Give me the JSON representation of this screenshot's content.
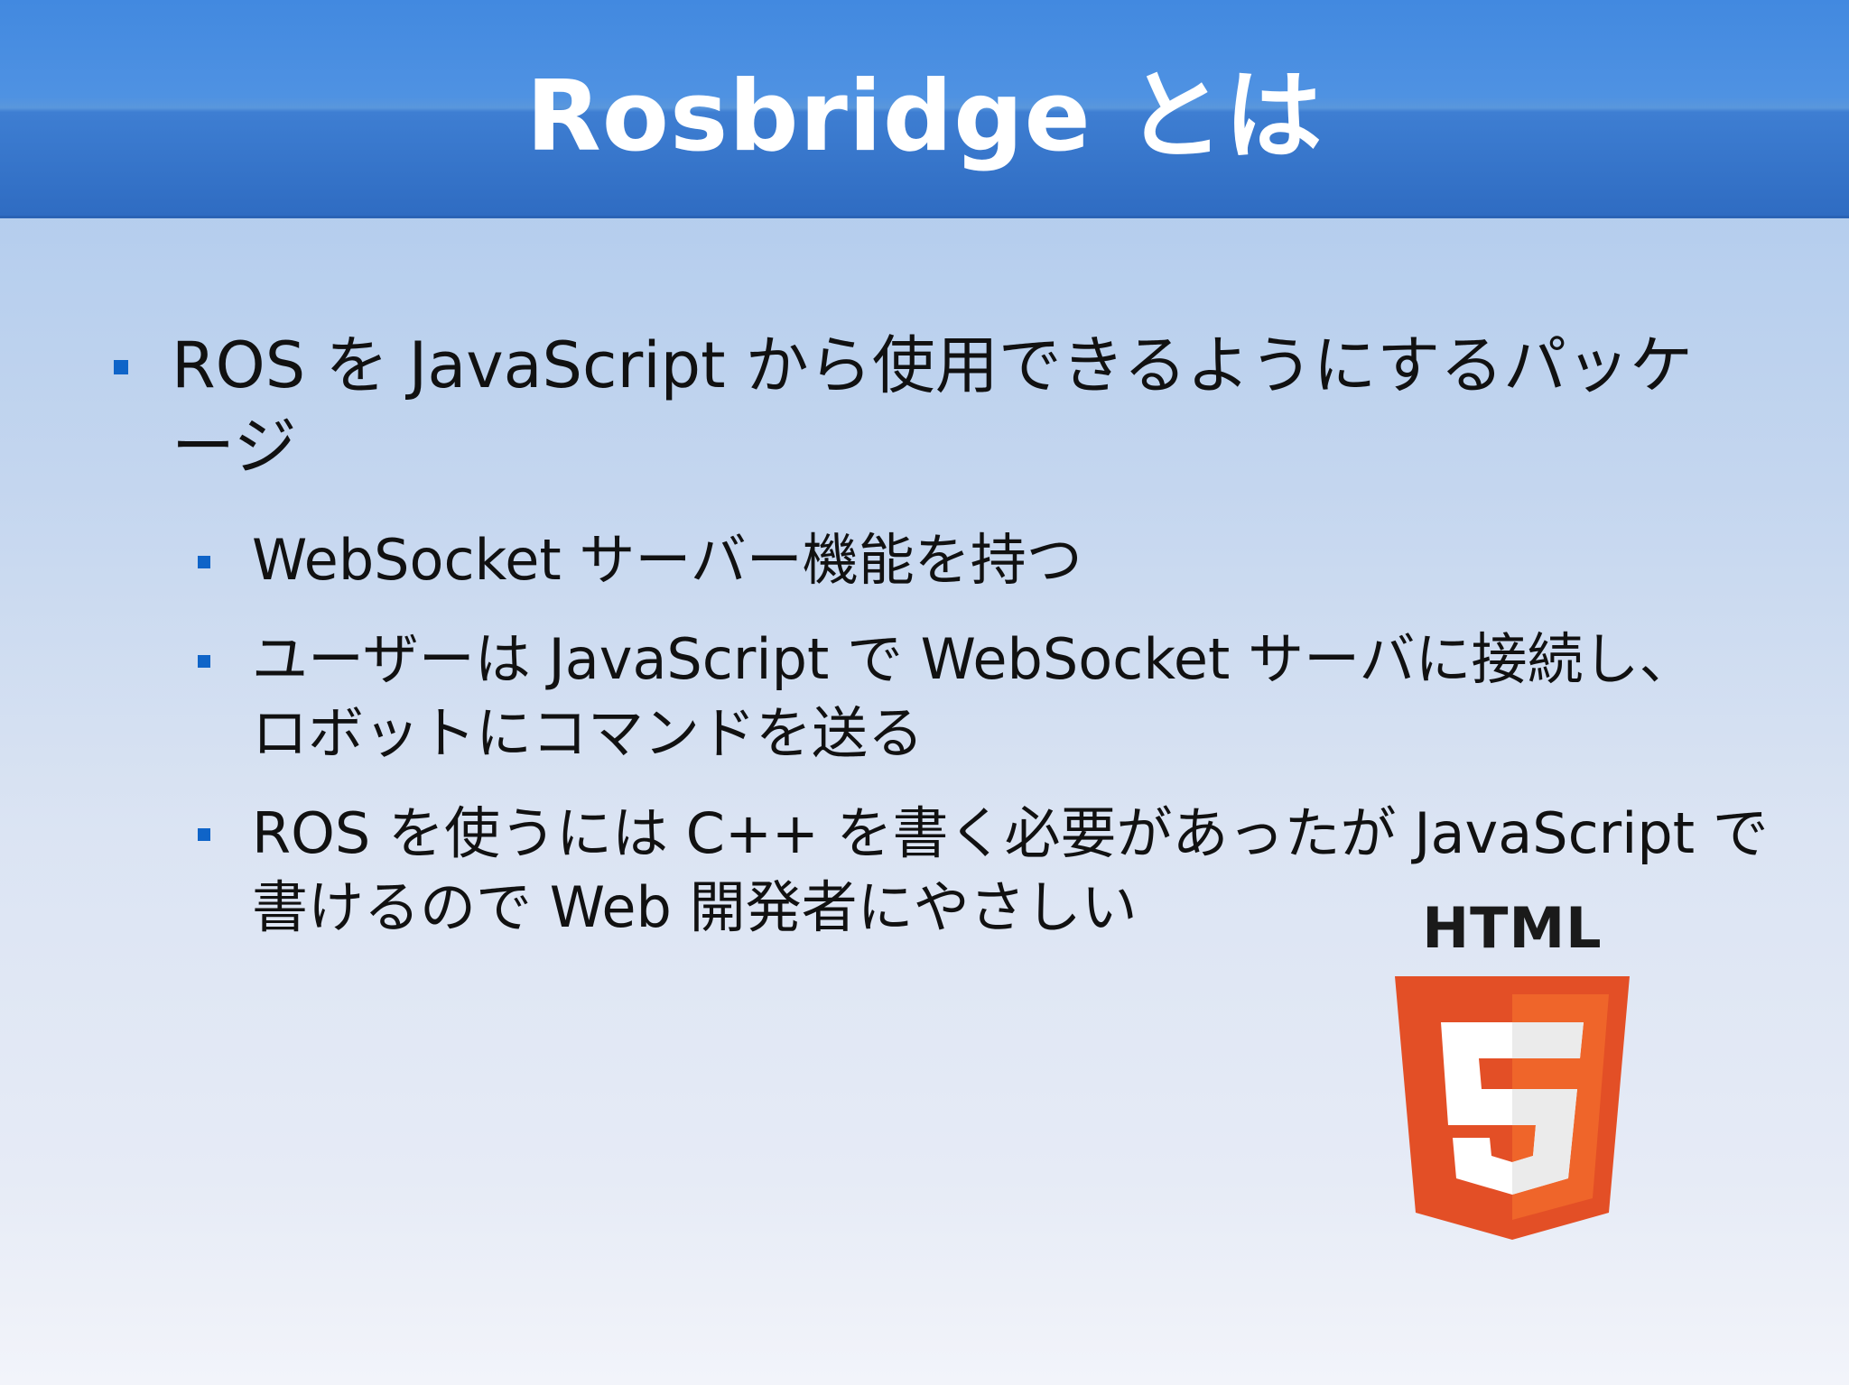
{
  "slide": {
    "title": "Rosbridge とは",
    "bullets": [
      {
        "text": "ROS を JavaScript から使用できるようにするパッケージ"
      },
      {
        "text": "WebSocket サーバー機能を持つ"
      },
      {
        "text": "ユーザーは JavaScript で WebSocket サーバに接続し、ロボットにコマンドを送る"
      },
      {
        "text": "ROS を使うには C++ を書く必要があったが JavaScript で書けるので Web 開発者にやさしい"
      }
    ],
    "logo": {
      "text": "HTML",
      "numeral": "5",
      "icon": "html5-logo-icon"
    }
  },
  "colors": {
    "title_bar": "#3a7fd6",
    "bullet": "#0f64c8",
    "logo_dark": "#e34f26",
    "logo_light": "#ef652a"
  }
}
